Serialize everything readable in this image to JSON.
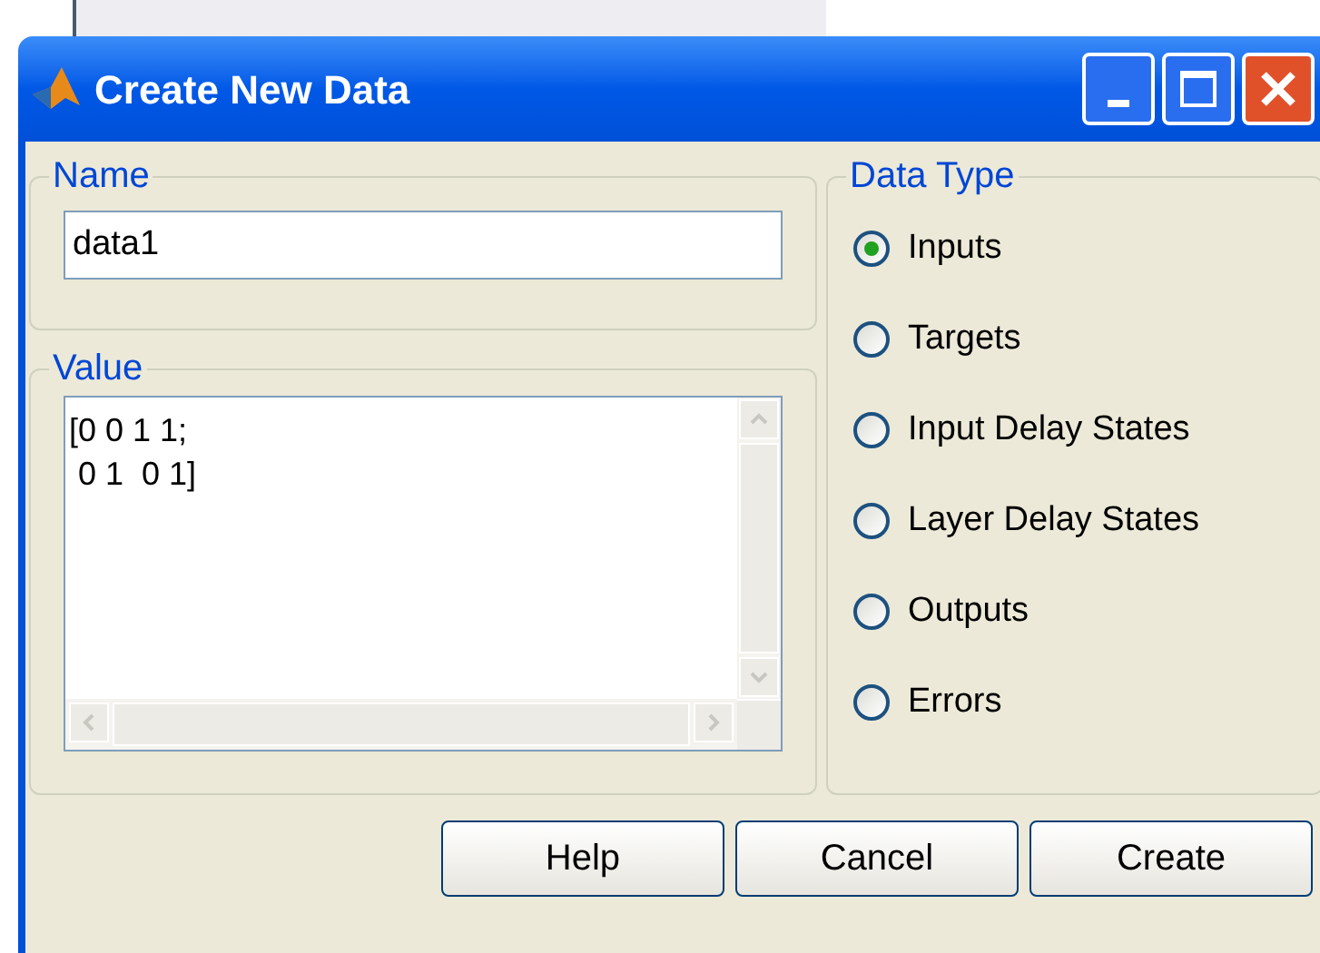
{
  "window": {
    "title": "Create New Data"
  },
  "name_group": {
    "label": "Name",
    "value": "data1"
  },
  "value_group": {
    "label": "Value",
    "lines": [
      "[0 0 1 1;",
      " 0 1  0 1]"
    ]
  },
  "data_type": {
    "label": "Data Type",
    "options": [
      {
        "label": "Inputs",
        "selected": true
      },
      {
        "label": "Targets",
        "selected": false
      },
      {
        "label": "Input Delay States",
        "selected": false
      },
      {
        "label": "Layer Delay States",
        "selected": false
      },
      {
        "label": "Outputs",
        "selected": false
      },
      {
        "label": "Errors",
        "selected": false
      }
    ]
  },
  "buttons": [
    "Help",
    "Cancel",
    "Create"
  ]
}
